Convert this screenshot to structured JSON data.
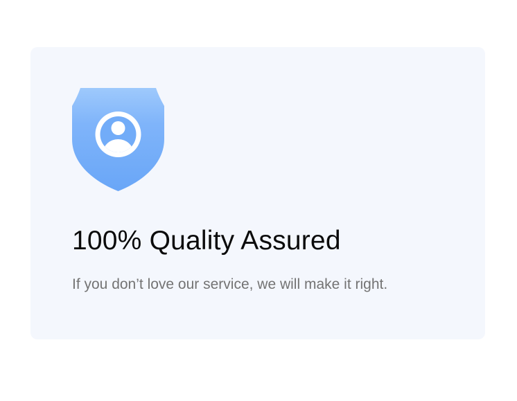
{
  "card": {
    "icon": "shield-user-icon",
    "title": "100% Quality Assured",
    "subtitle": "If you don’t love our service, we will make it right."
  },
  "colors": {
    "card_background": "#f4f7fd",
    "shield_top": "#96c3fb",
    "shield_bottom": "#6aa7f7",
    "title": "#0b0b0b",
    "subtitle": "#737373"
  }
}
